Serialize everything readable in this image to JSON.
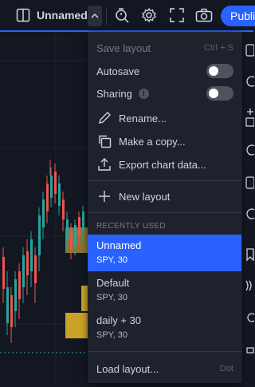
{
  "toolbar": {
    "layout_name": "Unnamed",
    "publish_label": "Publi"
  },
  "menu": {
    "save_layout": "Save layout",
    "save_shortcut": "Ctrl + S",
    "autosave": "Autosave",
    "sharing": "Sharing",
    "info_glyph": "i",
    "rename": "Rename...",
    "make_copy": "Make a copy...",
    "export": "Export chart data...",
    "new_layout": "New layout",
    "recently_used": "RECENTLY USED",
    "layouts": [
      {
        "name": "Unnamed",
        "detail": "SPY, 30"
      },
      {
        "name": "Default",
        "detail": "SPY, 30"
      },
      {
        "name": "daily + 30",
        "detail": "SPY, 30"
      }
    ],
    "load_layout": "Load layout...",
    "load_shortcut": "Dot"
  },
  "colors": {
    "accent": "#2962ff",
    "up": "#26a69a",
    "down": "#ef5350",
    "volume": "#c9a227"
  }
}
